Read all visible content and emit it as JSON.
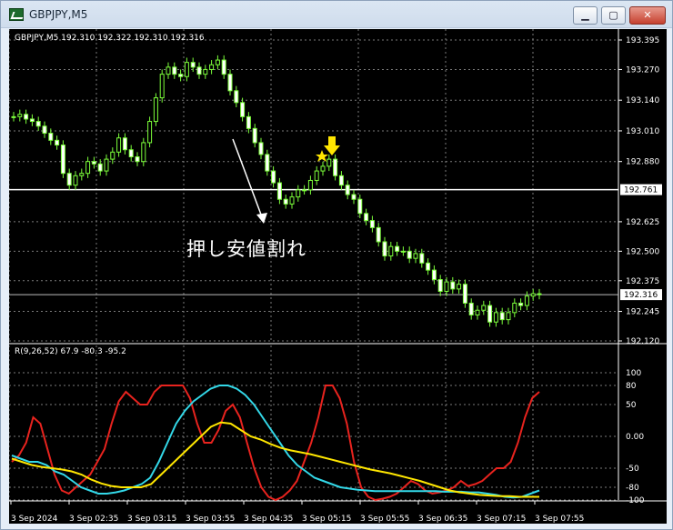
{
  "window": {
    "title": "GBPJPY,M5",
    "buttons": {
      "minimize": "▁",
      "maximize": "▢",
      "close": "✕"
    }
  },
  "chart": {
    "symbol_info": "GBPJPY,M5  192.310 192.322 192.310 192.316",
    "indicator_info": "R(9,26,52) 67.9 -80.3 -95.2",
    "annotation_text": "押し安値割れ",
    "price_labels": [
      "193.395",
      "193.270",
      "193.140",
      "193.010",
      "192.880",
      "192.625",
      "192.500",
      "192.375",
      "192.245",
      "192.120"
    ],
    "horizontal_line_label": "192.761",
    "current_price_label": "192.316",
    "osc_labels": [
      "100",
      "80",
      "50",
      "0.00",
      "-50",
      "-80",
      "-100"
    ],
    "time_labels": [
      "3 Sep 2024",
      "3 Sep 02:35",
      "3 Sep 03:15",
      "3 Sep 03:55",
      "3 Sep 04:35",
      "3 Sep 05:15",
      "3 Sep 05:55",
      "3 Sep 06:35",
      "3 Sep 07:15",
      "3 Sep 07:55"
    ]
  },
  "chart_data": {
    "type": "candlestick",
    "price_range": [
      192.12,
      193.395
    ],
    "osc_range": [
      -100,
      100
    ],
    "grid": true,
    "candle_color": "#7cff3a",
    "levels": [
      192.761,
      192.316
    ],
    "series": [
      {
        "name": "close",
        "values": [
          193.07,
          193.08,
          193.06,
          193.05,
          193.03,
          193.0,
          192.97,
          192.95,
          192.83,
          192.78,
          192.82,
          192.83,
          192.88,
          192.87,
          192.84,
          192.89,
          192.92,
          192.98,
          192.93,
          192.9,
          192.88,
          192.96,
          193.05,
          193.15,
          193.25,
          193.28,
          193.25,
          193.24,
          193.3,
          193.28,
          193.25,
          193.27,
          193.29,
          193.31,
          193.25,
          193.18,
          193.13,
          193.07,
          193.02,
          192.96,
          192.91,
          192.84,
          192.79,
          192.72,
          192.7,
          192.73,
          192.76,
          192.76,
          192.8,
          192.84,
          192.86,
          192.89,
          192.82,
          192.78,
          192.74,
          192.72,
          192.66,
          192.63,
          192.6,
          192.54,
          192.48,
          192.52,
          192.5,
          192.5,
          192.47,
          192.49,
          192.45,
          192.42,
          192.38,
          192.33,
          192.37,
          192.34,
          192.36,
          192.28,
          192.23,
          192.25,
          192.27,
          192.2,
          192.24,
          192.21,
          192.24,
          192.28,
          192.27,
          192.31,
          192.32,
          192.316
        ]
      },
      {
        "name": "osc_red",
        "values": [
          -40,
          -30,
          -10,
          30,
          20,
          -20,
          -60,
          -85,
          -90,
          -80,
          -70,
          -60,
          -40,
          -20,
          20,
          55,
          70,
          60,
          50,
          50,
          70,
          80,
          80,
          80,
          80,
          60,
          20,
          -10,
          -10,
          10,
          40,
          50,
          30,
          -10,
          -50,
          -80,
          -95,
          -100,
          -95,
          -85,
          -70,
          -40,
          -10,
          30,
          80,
          80,
          60,
          20,
          -40,
          -80,
          -95,
          -100,
          -98,
          -95,
          -90,
          -80,
          -70,
          -75,
          -85,
          -90,
          -88,
          -85,
          -80,
          -70,
          -78,
          -75,
          -70,
          -60,
          -50,
          -50,
          -40,
          -10,
          30,
          60,
          70
        ]
      },
      {
        "name": "osc_cyan",
        "values": [
          -30,
          -35,
          -40,
          -40,
          -45,
          -55,
          -60,
          -70,
          -80,
          -85,
          -90,
          -90,
          -88,
          -85,
          -80,
          -75,
          -65,
          -40,
          -10,
          20,
          40,
          55,
          65,
          75,
          80,
          80,
          75,
          65,
          50,
          30,
          10,
          -10,
          -30,
          -45,
          -55,
          -65,
          -70,
          -75,
          -80,
          -82,
          -84,
          -85,
          -86,
          -86,
          -86,
          -86,
          -86,
          -86,
          -86,
          -86,
          -87,
          -87,
          -87,
          -88,
          -88,
          -90,
          -92,
          -95,
          -96,
          -95,
          -90,
          -85
        ]
      },
      {
        "name": "osc_yellow",
        "values": [
          -35,
          -40,
          -45,
          -48,
          -50,
          -52,
          -55,
          -60,
          -68,
          -74,
          -78,
          -80,
          -80,
          -80,
          -75,
          -60,
          -45,
          -30,
          -15,
          0,
          15,
          22,
          20,
          10,
          0,
          -5,
          -12,
          -18,
          -22,
          -25,
          -28,
          -32,
          -36,
          -40,
          -44,
          -48,
          -52,
          -55,
          -58,
          -62,
          -66,
          -70,
          -75,
          -80,
          -85,
          -88,
          -90,
          -92,
          -93,
          -94,
          -94,
          -95,
          -95,
          -95
        ]
      }
    ]
  }
}
